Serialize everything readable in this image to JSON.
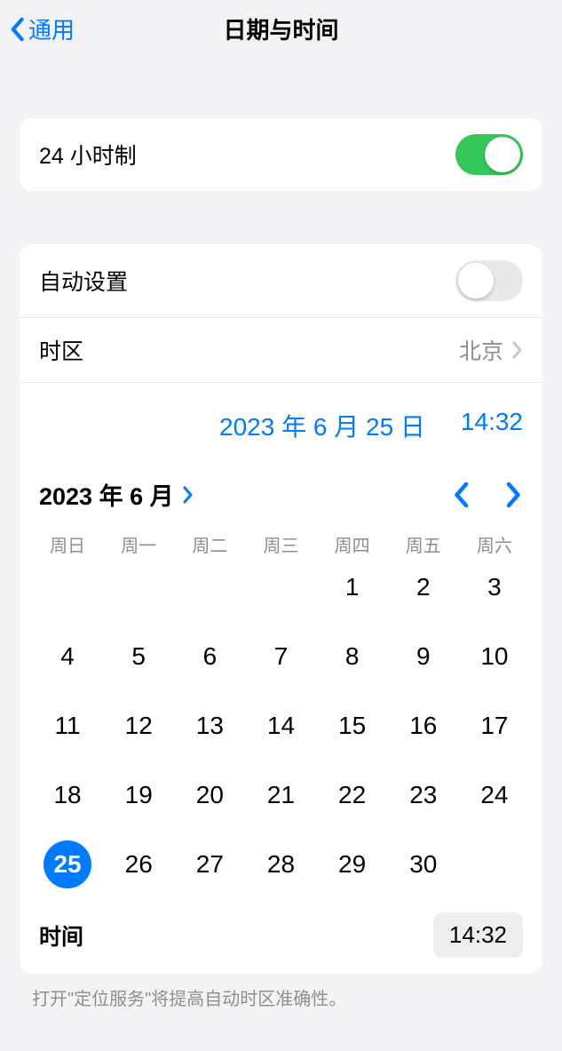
{
  "nav": {
    "back": "通用",
    "title": "日期与时间"
  },
  "twentyFourHour": {
    "label": "24 小时制",
    "on": true
  },
  "autoSet": {
    "label": "自动设置",
    "on": false
  },
  "timezone": {
    "label": "时区",
    "value": "北京"
  },
  "selectedDate": "2023 年 6 月 25 日",
  "selectedTime": "14:32",
  "monthTitle": "2023 年 6 月",
  "weekdays": [
    "周日",
    "周一",
    "周二",
    "周三",
    "周四",
    "周五",
    "周六"
  ],
  "calendar": {
    "startOffset": 4,
    "daysInMonth": 30,
    "selectedDay": 25
  },
  "timeRow": {
    "label": "时间",
    "value": "14:32"
  },
  "footer": "打开\"定位服务\"将提高自动时区准确性。",
  "colors": {
    "accent": "#007aff",
    "green": "#34c759"
  }
}
